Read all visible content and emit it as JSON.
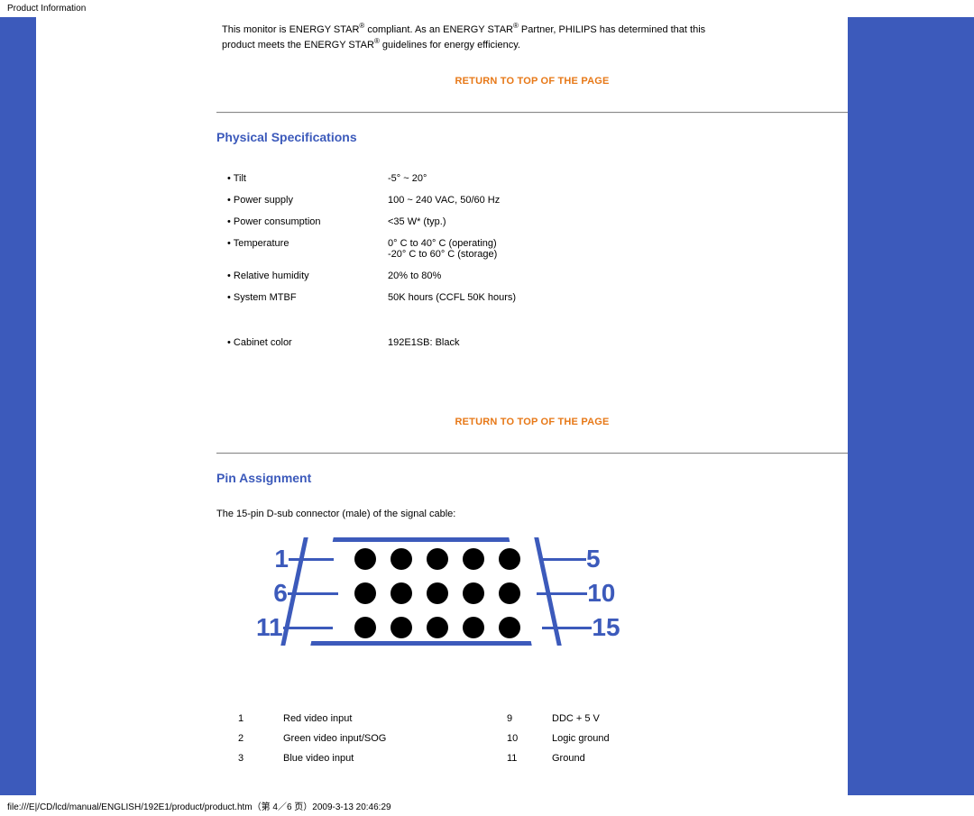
{
  "header": {
    "title": "Product Information"
  },
  "intro": {
    "line1a": "This monitor is ENERGY STAR",
    "line1b": " compliant. As an ENERGY STAR",
    "line1c": " Partner, PHILIPS has determined that this",
    "line2a": "product meets the ENERGY STAR",
    "line2b": " guidelines for energy efficiency."
  },
  "return_label": "RETURN TO TOP OF THE PAGE",
  "physical": {
    "heading": "Physical Specifications",
    "rows": [
      {
        "label": "• Tilt",
        "value": "-5° ~ 20°"
      },
      {
        "label": "• Power supply",
        "value": "100 ~ 240 VAC, 50/60 Hz"
      },
      {
        "label": "• Power consumption",
        "value": "<35 W* (typ.)"
      },
      {
        "label": "• Temperature",
        "value": "0° C to 40° C (operating)\n-20° C to 60° C (storage)"
      },
      {
        "label": "• Relative humidity",
        "value": "20% to 80%"
      },
      {
        "label": "• System MTBF",
        "value": "50K hours (CCFL 50K hours)"
      },
      {
        "label": "• Cabinet color",
        "value": "192E1SB: Black"
      }
    ]
  },
  "pin": {
    "heading": "Pin Assignment",
    "desc": "The 15-pin D-sub connector (male) of the signal cable:",
    "labels": {
      "l1": "1",
      "l2": "6",
      "l3": "11",
      "r1": "5",
      "r2": "10",
      "r3": "15"
    },
    "rows": [
      {
        "n1": "1",
        "t1": "Red video input",
        "n2": "9",
        "t2": "DDC + 5 V"
      },
      {
        "n1": "2",
        "t1": "Green video input/SOG",
        "n2": "10",
        "t2": "Logic ground"
      },
      {
        "n1": "3",
        "t1": "Blue video input",
        "n2": "11",
        "t2": "Ground"
      }
    ]
  },
  "footer": {
    "text": "file:///E|/CD/lcd/manual/ENGLISH/192E1/product/product.htm（第 4／6 页）2009-3-13 20:46:29"
  }
}
